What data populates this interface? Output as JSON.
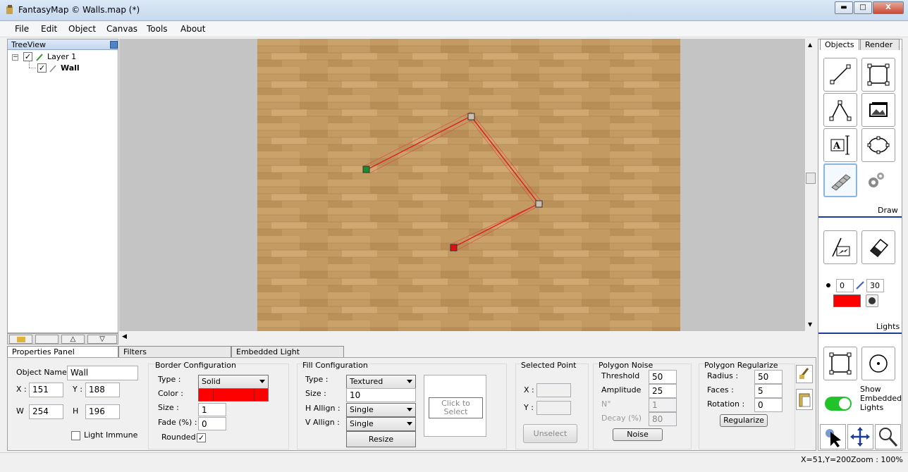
{
  "window": {
    "title": "FantasyMap © Walls.map (*)",
    "minimize": "▬",
    "maximize": "□",
    "close": "X"
  },
  "menu": [
    "File",
    "Edit",
    "Object",
    "Canvas",
    "Tools",
    "About"
  ],
  "treeview": {
    "header": "TreeView",
    "layer": "Layer 1",
    "item": "Wall"
  },
  "bottom_tabs": [
    "Properties Panel",
    "Filters",
    "Embedded Light"
  ],
  "object": {
    "name_label": "Object Name",
    "name": "Wall",
    "x_label": "X :",
    "x": "151",
    "y_label": "Y :",
    "y": "188",
    "w_label": "W",
    "w": "254",
    "h_label": "H",
    "h": "196",
    "light_immune": "Light Immune"
  },
  "border": {
    "title": "Border Configuration",
    "type_label": "Type :",
    "type": "Solid",
    "color_label": "Color :",
    "color": "#ff0000",
    "size_label": "Size :",
    "size": "1",
    "fade_label": "Fade (%) :",
    "fade": "0",
    "rounded": "Rounded"
  },
  "fill": {
    "title": "Fill Configuration",
    "type_label": "Type :",
    "type": "Textured",
    "size_label": "Size :",
    "size": "10",
    "halign_label": "H Allign :",
    "halign": "Single",
    "valign_label": "V Allign :",
    "valign": "Single",
    "resize": "Resize",
    "click_select": "Click to Select"
  },
  "selected_point": {
    "title": "Selected Point",
    "x_label": "X :",
    "y_label": "Y :",
    "unselect": "Unselect"
  },
  "noise": {
    "title": "Polygon Noise",
    "threshold_label": "Threshold",
    "threshold": "50",
    "amplitude_label": "Amplitude",
    "amplitude": "25",
    "n_label": "N°",
    "n": "1",
    "decay_label": "Decay (%)",
    "decay": "80",
    "button": "Noise"
  },
  "regularize": {
    "title": "Polygon Regularize",
    "radius_label": "Radius :",
    "radius": "50",
    "faces_label": "Faces :",
    "faces": "5",
    "rotation_label": "Rotation :",
    "rotation": "0",
    "button": "Regularize"
  },
  "right_tabs": [
    "Objects",
    "Render"
  ],
  "right": {
    "draw": "Draw",
    "lights": "Lights",
    "light_a": "0",
    "light_b": "30",
    "light_color": "#ff0000",
    "show_embedded": "Show Embedded Lights"
  },
  "status": {
    "coords": "X=51,Y=200",
    "zoom": "Zoom : 100%"
  },
  "icons": [
    "line-tool-icon",
    "rectangle-tool-icon",
    "polyline-tool-icon",
    "image-tool-icon",
    "text-tool-icon",
    "ellipse-tool-icon",
    "wall-tool-icon",
    "settings-gears-icon",
    "light-brush-icon",
    "eraser-icon",
    "select-cursor-icon",
    "pan-move-icon",
    "zoom-icon"
  ]
}
